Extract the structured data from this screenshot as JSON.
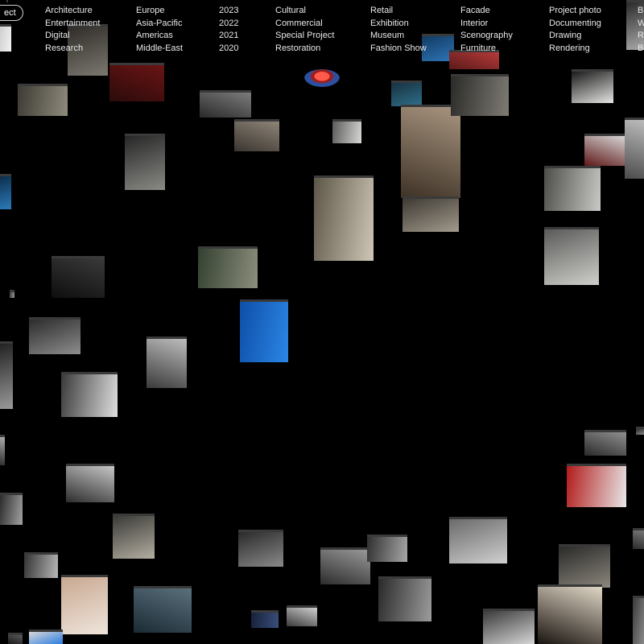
{
  "filters": {
    "active_pill": "ect",
    "columns": [
      {
        "name": "type",
        "items": [
          "Architecture",
          "Entertainment",
          "Digital",
          "Research"
        ]
      },
      {
        "name": "region",
        "items": [
          "Europe",
          "Asia-Pacific",
          "Americas",
          "Middle-East"
        ]
      },
      {
        "name": "year",
        "items": [
          "2023",
          "2022",
          "2021",
          "2020"
        ]
      },
      {
        "name": "category",
        "items": [
          "Cultural",
          "Commercial",
          "Special Project",
          "Restoration"
        ]
      },
      {
        "name": "program",
        "items": [
          "Retail",
          "Exhibition",
          "Museum",
          "Fashion Show"
        ]
      },
      {
        "name": "scope",
        "items": [
          "Facade",
          "Interior",
          "Scenography",
          "Furniture"
        ]
      },
      {
        "name": "media",
        "items": [
          "Project photo",
          "Documenting",
          "Drawing",
          "Rendering"
        ]
      },
      {
        "name": "extra",
        "items": [
          "B",
          "W",
          "R",
          "B"
        ]
      }
    ]
  },
  "thumbnails": [
    {
      "id": 1,
      "colors": [
        "#2f2c28",
        "#7b7870"
      ]
    },
    {
      "id": 2,
      "colors": [
        "#2b0b0b",
        "#6a1414"
      ]
    },
    {
      "id": 3,
      "colors": [
        "#3c3a33",
        "#8f8b7c"
      ]
    },
    {
      "id": 4,
      "colors": [
        "#262626",
        "#8a8a86"
      ]
    },
    {
      "id": 5,
      "colors": [
        "#3a3530",
        "#8e8578"
      ]
    },
    {
      "id": 6,
      "colors": [
        "#5b5b5b",
        "#d8d8d6"
      ]
    },
    {
      "id": 7,
      "colors": [
        "#173240",
        "#2f6f8a"
      ]
    },
    {
      "id": 8,
      "colors": [
        "#3e3226",
        "#a89580"
      ]
    },
    {
      "id": 9,
      "colors": [
        "#2a2a28",
        "#7f7c74"
      ]
    },
    {
      "id": 10,
      "colors": [
        "#1a1a1a",
        "#e6e6e4"
      ]
    },
    {
      "id": 11,
      "colors": [
        "#2a2a2a",
        "#7c7c7c"
      ]
    },
    {
      "id": 12,
      "colors": [
        "#5c5648",
        "#cfc7b6"
      ]
    },
    {
      "id": 13,
      "colors": [
        "#3e3a34",
        "#a29a8c"
      ]
    },
    {
      "id": 14,
      "colors": [
        "#5e1818",
        "#d8d8d8"
      ]
    },
    {
      "id": 15,
      "colors": [
        "#4d4d4a",
        "#c9c9c6"
      ]
    },
    {
      "id": 16,
      "colors": [
        "#0d2e4a",
        "#2b7bbb"
      ]
    },
    {
      "id": 17,
      "colors": [
        "#0e0e0e",
        "#3a3a3a"
      ]
    },
    {
      "id": 18,
      "colors": [
        "#334030",
        "#8d8f7e"
      ]
    },
    {
      "id": 19,
      "colors": [
        "#5a5a58",
        "#cfcfcc"
      ]
    },
    {
      "id": 20,
      "colors": [
        "#4b4b4b",
        "#bcbcbc"
      ]
    },
    {
      "id": 21,
      "colors": [
        "#0d4fa8",
        "#2c86e6"
      ]
    },
    {
      "id": 22,
      "colors": [
        "#2c2c2c",
        "#8d8d8d"
      ]
    },
    {
      "id": 23,
      "colors": [
        "#3a3a3a",
        "#bdbdbd"
      ]
    },
    {
      "id": 24,
      "colors": [
        "#3a3a3a",
        "#e0e0e0"
      ]
    },
    {
      "id": 25,
      "colors": [
        "#222",
        "#9a9a9a"
      ]
    },
    {
      "id": 26,
      "colors": [
        "#2d2d2d",
        "#c6c6c6"
      ]
    },
    {
      "id": 27,
      "colors": [
        "#2b2b2b",
        "#a3a3a3"
      ]
    },
    {
      "id": 28,
      "colors": [
        "#3a3a36",
        "#b4aea2"
      ]
    },
    {
      "id": 29,
      "colors": [
        "#2a2a2a",
        "#909090"
      ]
    },
    {
      "id": 30,
      "colors": [
        "#b21b1b",
        "#e8e8e8"
      ]
    },
    {
      "id": 31,
      "colors": [
        "#2a2a2a",
        "#8a8a8a"
      ]
    },
    {
      "id": 32,
      "colors": [
        "#2c2c2c",
        "#9a9a9a"
      ]
    },
    {
      "id": 33,
      "colors": [
        "#2f2f2f",
        "#a8a8a8"
      ]
    },
    {
      "id": 34,
      "colors": [
        "#6a6a6a",
        "#d0d0d0"
      ]
    },
    {
      "id": 35,
      "colors": [
        "#2e2e2e",
        "#ababab"
      ]
    },
    {
      "id": 36,
      "colors": [
        "#333",
        "#b8b8b8"
      ]
    },
    {
      "id": 37,
      "colors": [
        "#2a2a28",
        "#8c877e"
      ]
    },
    {
      "id": 38,
      "colors": [
        "#1b2b34",
        "#5a6f7c"
      ]
    },
    {
      "id": 39,
      "colors": [
        "#2a2a2a",
        "#9c9c9c"
      ]
    },
    {
      "id": 40,
      "colors": [
        "#c9a891",
        "#efe5dc"
      ]
    },
    {
      "id": 41,
      "colors": [
        "#3a3a3a",
        "#cfcfcf"
      ]
    },
    {
      "id": 42,
      "colors": [
        "#16203a",
        "#3a4f7a"
      ]
    },
    {
      "id": 43,
      "colors": [
        "#3a3a3a",
        "#d6d6d6"
      ]
    },
    {
      "id": 44,
      "colors": [
        "#1a1410",
        "#e0d7c6"
      ]
    },
    {
      "id": 45,
      "colors": [
        "#cfcfcf",
        "#f2f2f2"
      ]
    },
    {
      "id": 46,
      "colors": [
        "#d9d9d9",
        "#2a7de0"
      ]
    },
    {
      "id": 47,
      "colors": [
        "#2a2a2a",
        "#777"
      ]
    },
    {
      "id": 48,
      "colors": [
        "#3a3a3a",
        "#8a8a8a"
      ]
    },
    {
      "id": 49,
      "colors": [
        "#123a60",
        "#2d75b8"
      ]
    },
    {
      "id": 50,
      "colors": [
        "#5a1a1a",
        "#b63a3a"
      ]
    },
    {
      "id": 51,
      "colors": [
        "#0e2a44",
        "#3b6f9e"
      ]
    },
    {
      "id": 52,
      "colors": [
        "#2a2a2a",
        "#aaaaaa"
      ]
    },
    {
      "id": 53,
      "colors": [
        "#1a1a1a",
        "#5a5a5a"
      ]
    },
    {
      "id": 54,
      "colors": [
        "#3a3a3a",
        "#9a9a9a"
      ]
    },
    {
      "id": 55,
      "colors": [
        "#2a2a2a",
        "#8a8a8a"
      ]
    }
  ]
}
